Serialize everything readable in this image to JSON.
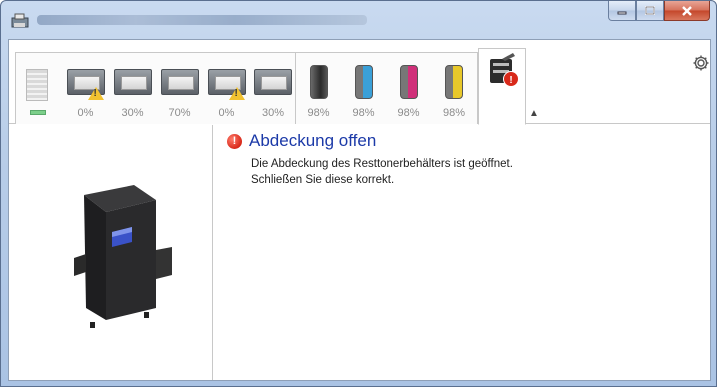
{
  "window": {
    "title_text": ""
  },
  "trays": [
    {
      "name": "manual-tray",
      "percent": ""
    },
    {
      "name": "cassette-1",
      "percent": "0%",
      "warning": true
    },
    {
      "name": "cassette-2",
      "percent": "30%",
      "warning": false
    },
    {
      "name": "cassette-3",
      "percent": "70%",
      "warning": false
    },
    {
      "name": "cassette-4",
      "percent": "0%",
      "warning": true
    },
    {
      "name": "cassette-5",
      "percent": "30%",
      "warning": false
    }
  ],
  "toners": [
    {
      "name": "black",
      "percent": "98%",
      "color": "#3c3c3c"
    },
    {
      "name": "cyan",
      "percent": "98%",
      "color": "#3aa0d8"
    },
    {
      "name": "magenta",
      "percent": "98%",
      "color": "#d0307a"
    },
    {
      "name": "yellow",
      "percent": "98%",
      "color": "#e8c82a"
    }
  ],
  "message": {
    "title": "Abdeckung offen",
    "line1": "Die Abdeckung des Resttonerbehälters ist geöffnet.",
    "line2": "Schließen Sie diese korrekt.",
    "icon": "error-icon"
  },
  "colors": {
    "accent": "#1c3aa8",
    "error": "#d8291a",
    "warning": "#f2c230"
  }
}
